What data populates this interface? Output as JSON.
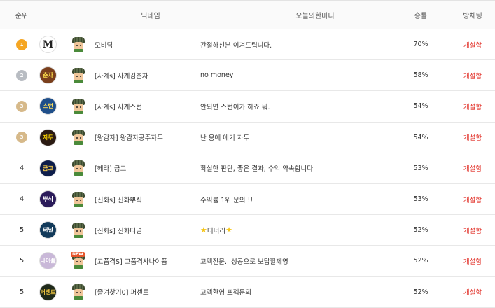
{
  "header": {
    "rank": "순위",
    "nickname": "닉네임",
    "message": "오늘의한마디",
    "winrate": "승률",
    "chat": "방채팅"
  },
  "rows": [
    {
      "rank": "1",
      "medal": "gold",
      "logo_text": "M",
      "logo_bg": "#ffffff",
      "logo_fg": "#222222",
      "nickname": "모비딕",
      "message": "간절하신분 이겨드립니다.",
      "winrate": "70%",
      "chat": "개설함",
      "new": false
    },
    {
      "rank": "2",
      "medal": "silver",
      "logo_text": "춘자",
      "logo_bg": "#7a3f1c",
      "logo_fg": "#ffe14d",
      "nickname": "[사계s] 사계김춘자",
      "message": "no money",
      "winrate": "58%",
      "chat": "개설함",
      "new": false
    },
    {
      "rank": "3",
      "medal": "bronze",
      "logo_text": "스턴",
      "logo_bg": "#1f4f8a",
      "logo_fg": "#ffde59",
      "nickname": "[사계s] 사계스턴",
      "message": "안되면 스턴이가 하죠 뭐.",
      "winrate": "54%",
      "chat": "개설함",
      "new": false
    },
    {
      "rank": "3",
      "medal": "bronze",
      "logo_text": "자두",
      "logo_bg": "#2a1a12",
      "logo_fg": "#ffd700",
      "nickname": "[왕감자] 왕감자공주자두",
      "message": "난 응애 애기 자두",
      "winrate": "54%",
      "chat": "개설함",
      "new": false
    },
    {
      "rank": "4",
      "medal": "",
      "logo_text": "금고",
      "logo_bg": "#0d1d4a",
      "logo_fg": "#ffd24a",
      "nickname": "[헤라] 금고",
      "message": "확실한 판단, 좋은 결과, 수익 약속합니다.",
      "winrate": "53%",
      "chat": "개설함",
      "new": false
    },
    {
      "rank": "4",
      "medal": "",
      "logo_text": "뿌식",
      "logo_bg": "#2b1b5a",
      "logo_fg": "#ffffff",
      "nickname": "[신화s] 신화뿌식",
      "message": "수익률 1위 문의 !!",
      "winrate": "53%",
      "chat": "개설함",
      "new": false
    },
    {
      "rank": "5",
      "medal": "",
      "logo_text": "터널",
      "logo_bg": "#123a5a",
      "logo_fg": "#ffffff",
      "nickname": "[신화s] 신화터널",
      "message": "터너리",
      "winrate": "52%",
      "chat": "개설함",
      "new": false,
      "stars": true
    },
    {
      "rank": "5",
      "medal": "",
      "logo_text": "나이퓸",
      "logo_bg": "#c9b8d8",
      "logo_fg": "#ffffff",
      "nickname": "[고품격S] ",
      "nickname_link": "고품격사나이퓸",
      "message": "고액전문...성공으로 보답할께영",
      "winrate": "52%",
      "chat": "개설함",
      "new": true
    },
    {
      "rank": "5",
      "medal": "",
      "logo_text": "퍼센트",
      "logo_bg": "#1f2a1a",
      "logo_fg": "#e8c040",
      "nickname": "[즐겨찾기0] 퍼센트",
      "message": "고액환영 프젝문의",
      "winrate": "52%",
      "chat": "개설함",
      "new": false
    }
  ],
  "colors": {
    "gold": "#f5a623",
    "silver": "#b8bcc2",
    "bronze": "#d6b98a",
    "chat": "#e0281f"
  }
}
